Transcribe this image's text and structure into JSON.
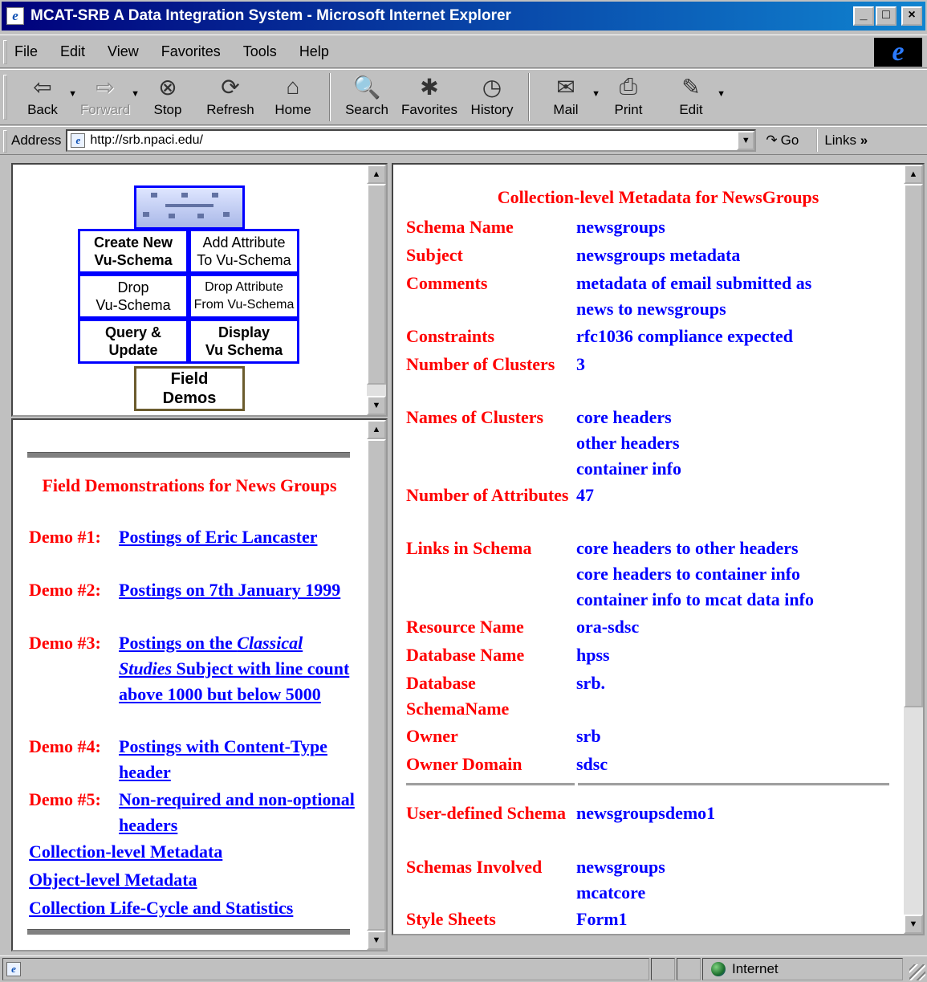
{
  "window": {
    "title": "MCAT-SRB A Data Integration System - Microsoft Internet Explorer",
    "min": "_",
    "max": "□",
    "close": "×"
  },
  "menu": [
    "File",
    "Edit",
    "View",
    "Favorites",
    "Tools",
    "Help"
  ],
  "toolbar": {
    "back": "Back",
    "forward": "Forward",
    "stop": "Stop",
    "refresh": "Refresh",
    "home": "Home",
    "search": "Search",
    "favorites": "Favorites",
    "history": "History",
    "mail": "Mail",
    "print": "Print",
    "edit": "Edit"
  },
  "address": {
    "label": "Address",
    "url": "http://srb.npaci.edu/",
    "go": "Go",
    "links": "Links"
  },
  "nav_map": {
    "create_new": [
      "Create New",
      "Vu-Schema"
    ],
    "add_attr": [
      "Add Attribute",
      "To Vu-Schema"
    ],
    "drop": [
      "Drop",
      "Vu-Schema"
    ],
    "drop_attr": [
      "Drop Attribute",
      "From Vu-Schema"
    ],
    "query": [
      "Query &",
      "Update"
    ],
    "display": [
      "Display",
      "Vu Schema"
    ],
    "field_demos": [
      "Field",
      "Demos"
    ]
  },
  "demos": {
    "heading": "Field Demonstrations for News Groups",
    "items": [
      {
        "label": "Demo #1:",
        "link": "Postings of Eric Lancaster"
      },
      {
        "label": "Demo #2:",
        "link": "Postings on 7th January 1999"
      },
      {
        "label": "Demo #3:",
        "link_pre": "Postings on the ",
        "link_em": "Classical Studies",
        "link_post": " Subject with line count above 1000 but below 5000"
      },
      {
        "label": "Demo #4:",
        "link": "Postings with Content-Type header"
      },
      {
        "label": "Demo #5:",
        "link": "Non-required and non-optional headers"
      }
    ],
    "links": [
      "Collection-level Metadata",
      "Object-level Metadata",
      "Collection Life-Cycle and Statistics"
    ]
  },
  "metadata": {
    "heading": "Collection-level Metadata for NewsGroups",
    "rows": [
      {
        "k": "Schema Name",
        "v": [
          "newsgroups"
        ]
      },
      {
        "k": "Subject",
        "v": [
          "newsgroups metadata"
        ]
      },
      {
        "k": "Comments",
        "v": [
          "metadata of email submitted as",
          "news to newsgroups"
        ]
      },
      {
        "k": "Constraints",
        "v": [
          "rfc1036 compliance expected"
        ]
      },
      {
        "k": "Number of Clusters",
        "v": [
          "3"
        ]
      },
      {
        "k": "Names of Clusters",
        "v": [
          "core headers",
          "other headers",
          "container info"
        ]
      },
      {
        "k": "Number of Attributes",
        "v": [
          "47"
        ]
      },
      {
        "k": "Links in Schema",
        "v": [
          "core headers to other headers",
          "core headers to container info",
          "container info to mcat data info"
        ]
      },
      {
        "k": "Resource Name",
        "v": [
          "ora-sdsc"
        ]
      },
      {
        "k": "Database Name",
        "v": [
          "hpss"
        ]
      },
      {
        "k": "Database SchemaName",
        "v": [
          "srb."
        ]
      },
      {
        "k": "Owner",
        "v": [
          "srb"
        ]
      },
      {
        "k": "Owner Domain",
        "v": [
          "sdsc"
        ]
      },
      {
        "k": "User-defined Schema",
        "v": [
          "newsgroupsdemo1"
        ]
      },
      {
        "k": "Schemas Involved",
        "v": [
          "newsgroups",
          "mcatcore"
        ]
      },
      {
        "k": "Style Sheets",
        "v": [
          "Form1"
        ]
      }
    ]
  },
  "status": {
    "zone": "Internet"
  }
}
